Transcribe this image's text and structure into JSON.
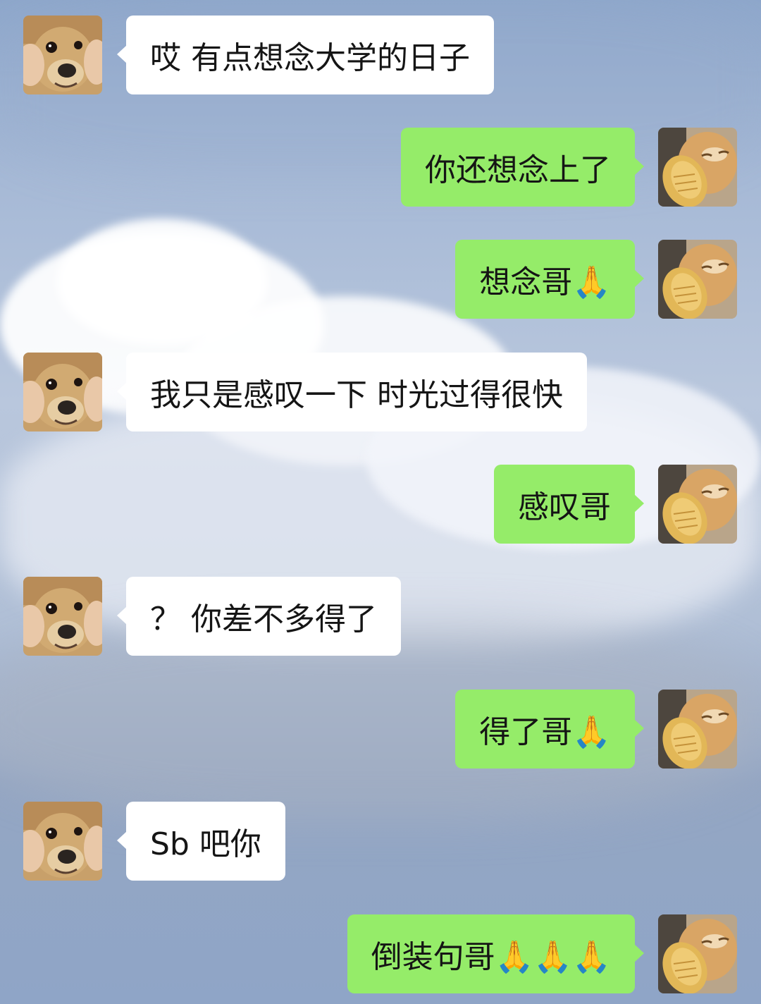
{
  "chat": {
    "messages": [
      {
        "side": "left",
        "text": "哎 有点想念大学的日子"
      },
      {
        "side": "right",
        "text": "你还想念上了"
      },
      {
        "side": "right",
        "text": "想念哥🙏"
      },
      {
        "side": "left",
        "text": "我只是感叹一下 时光过得很快"
      },
      {
        "side": "right",
        "text": "感叹哥"
      },
      {
        "side": "left",
        "text": "？ 你差不多得了"
      },
      {
        "side": "right",
        "text": "得了哥🙏"
      },
      {
        "side": "left",
        "text": "Sb 吧你"
      },
      {
        "side": "right",
        "text": "倒装句哥🙏🙏🙏"
      }
    ]
  },
  "avatars": {
    "left": "dog-avatar",
    "right": "cat-avatar"
  },
  "colors": {
    "incoming_bubble": "#ffffff",
    "outgoing_bubble": "#95ec69"
  }
}
